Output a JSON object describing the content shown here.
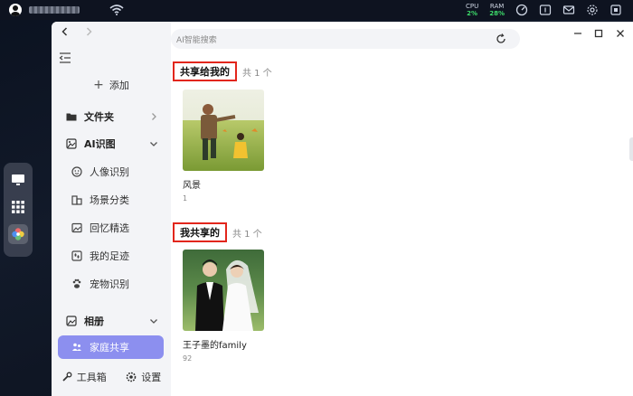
{
  "system": {
    "cpu_label": "CPU",
    "cpu_value": "2%",
    "ram_label": "RAM",
    "ram_value": "28%"
  },
  "sidebar": {
    "add_label": "添加",
    "sections": [
      {
        "label": "文件夹"
      },
      {
        "label": "AI识图"
      },
      {
        "label": "相册"
      }
    ],
    "ai_items": [
      {
        "label": "人像识别"
      },
      {
        "label": "场景分类"
      },
      {
        "label": "回忆精选"
      },
      {
        "label": "我的足迹"
      },
      {
        "label": "宠物识别"
      }
    ],
    "album_items": [
      {
        "label": "家庭共享"
      }
    ],
    "toolbox_label": "工具箱",
    "settings_label": "设置"
  },
  "search": {
    "placeholder": "AI智能搜索"
  },
  "groups": [
    {
      "title": "共享给我的",
      "count": "共 1 个",
      "albums": [
        {
          "name": "风景",
          "count": "1"
        }
      ]
    },
    {
      "title": "我共享的",
      "count": "共 1 个",
      "albums": [
        {
          "name": "王子墨的family",
          "count": "92"
        }
      ]
    }
  ],
  "colors": {
    "accent": "#8c8fef",
    "highlight_border": "#e2261c",
    "cpu_ram_value": "#3ddc6a"
  }
}
